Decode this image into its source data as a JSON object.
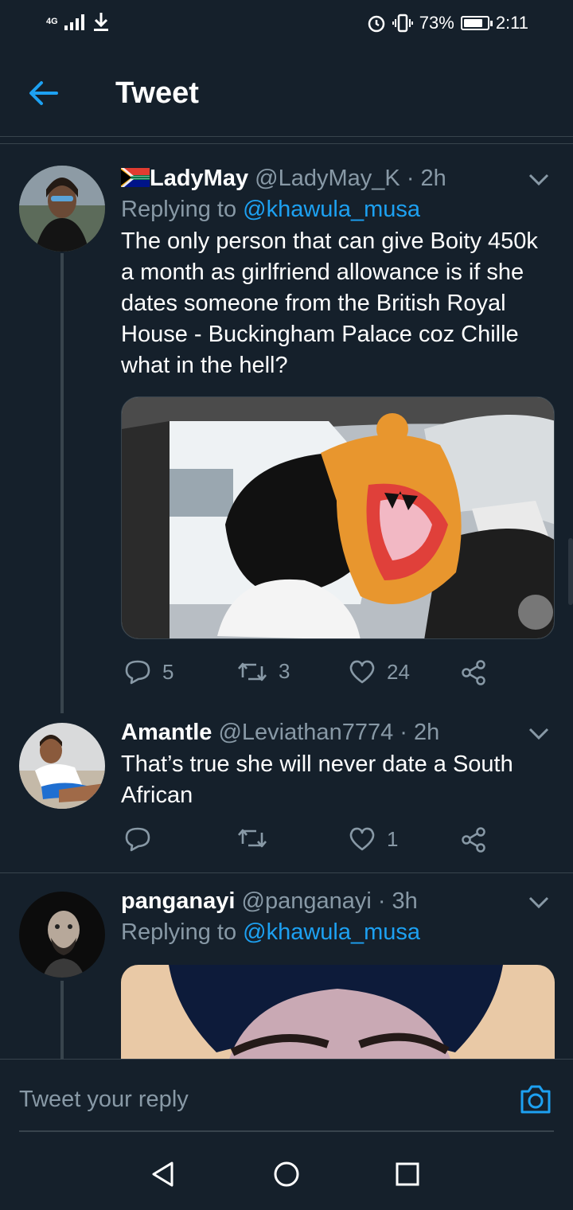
{
  "status_bar": {
    "network": "4G",
    "battery": "73%",
    "battery_level": 0.73,
    "time": "2:11"
  },
  "header": {
    "title": "Tweet",
    "back_icon": "back-arrow-icon"
  },
  "tweets": [
    {
      "display_name": "LadyMay",
      "handle": "@LadyMay_K",
      "time": "· 2h",
      "replying_label": "Replying to",
      "replying_to": "@khawula_musa",
      "text": "The only person that can give Boity 450k a month as girlfriend allowance is if she dates someone from the British Royal House - Buckingham Palace coz Chille what in the hell?",
      "has_flag": true,
      "replies": "5",
      "retweets": "3",
      "likes": "24"
    },
    {
      "display_name": "Amantle",
      "handle": "@Leviathan7774",
      "time": "· 2h",
      "text": "That’s true she will  never date a South African",
      "replies": "",
      "retweets": "",
      "likes": "1"
    },
    {
      "display_name": "panganayi",
      "handle": "@panganayi",
      "time": "· 3h",
      "replying_label": "Replying to",
      "replying_to": "@khawula_musa"
    }
  ],
  "reply_bar": {
    "placeholder": "Tweet your reply"
  },
  "colors": {
    "background": "#15202b",
    "accent": "#1da1f2",
    "secondary_text": "#8899a6",
    "divider": "#38444d"
  }
}
